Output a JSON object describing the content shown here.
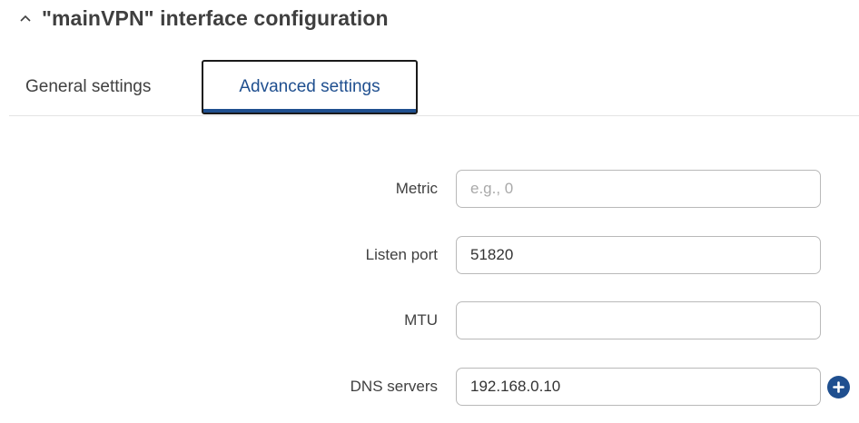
{
  "header": {
    "title": "\"mainVPN\" interface configuration",
    "collapse_icon": "chevron-up-icon"
  },
  "tabs": [
    {
      "label": "General settings",
      "active": false
    },
    {
      "label": "Advanced settings",
      "active": true
    }
  ],
  "form": {
    "metric": {
      "label": "Metric",
      "value": "",
      "placeholder": "e.g., 0"
    },
    "listen_port": {
      "label": "Listen port",
      "value": "51820",
      "placeholder": ""
    },
    "mtu": {
      "label": "MTU",
      "value": "",
      "placeholder": ""
    },
    "dns_servers": {
      "label": "DNS servers",
      "value": "192.168.0.10",
      "placeholder": "",
      "add_icon": "plus-circle-icon"
    }
  },
  "colors": {
    "accent": "#1f4f8f",
    "text": "#404040",
    "border": "#b9b9b9"
  }
}
